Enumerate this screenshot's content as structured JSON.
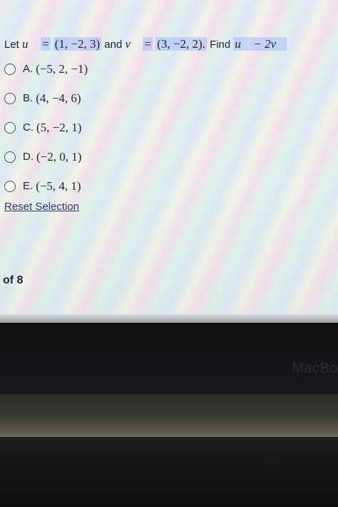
{
  "question": {
    "prefix": "Let",
    "u_symbol": "u⃗",
    "equals1": "=",
    "u_value": "(1, −2, 3)",
    "and_text": "and",
    "v_symbol": "v⃗",
    "equals2": "=",
    "v_value": "(3, −2, 2).",
    "find_text": "Find",
    "expression": "u⃗ − 2v⃗"
  },
  "options": [
    {
      "letter": "A.",
      "value": "(−5, 2, −1)"
    },
    {
      "letter": "B.",
      "value": "(4, −4, 6)"
    },
    {
      "letter": "C.",
      "value": "(5, −2, 1)"
    },
    {
      "letter": "D.",
      "value": "(−2, 0, 1)"
    },
    {
      "letter": "E.",
      "value": "(−5, 4, 1)"
    }
  ],
  "reset_label": "Reset Selection",
  "page_count": "of 8",
  "device_brand": "MacBo"
}
